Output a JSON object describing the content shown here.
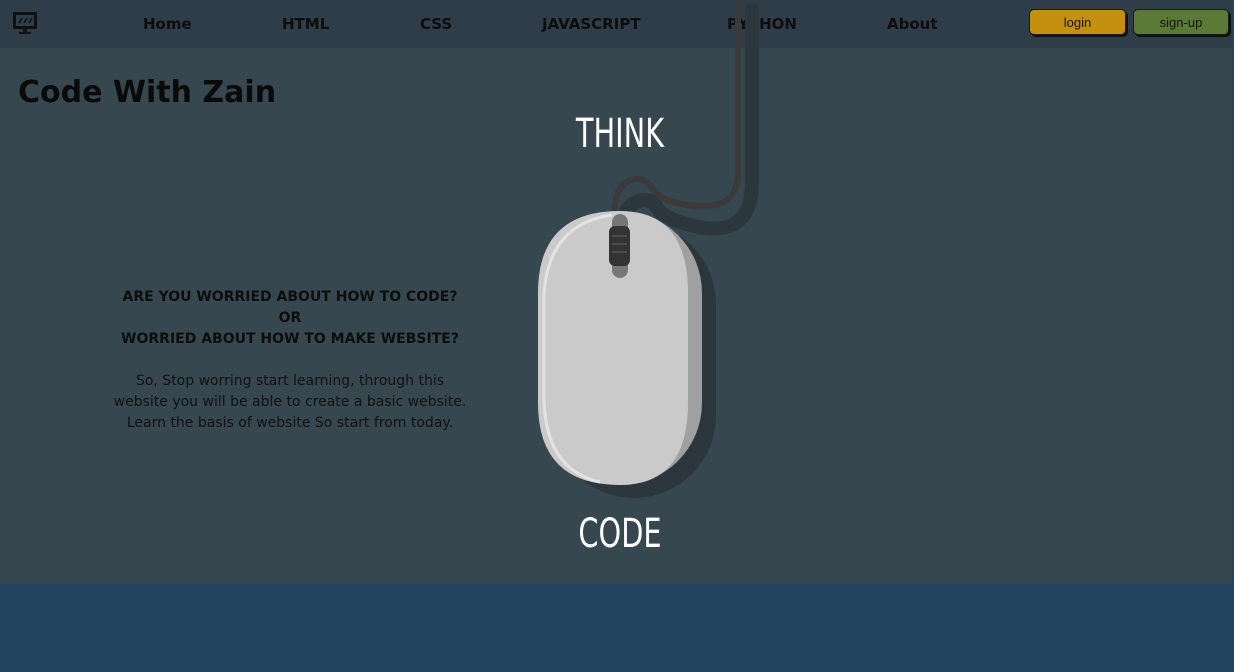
{
  "nav": {
    "logo_icon": "monitor-icon",
    "links": [
      {
        "label": "Home"
      },
      {
        "label": "HTML"
      },
      {
        "label": "CSS"
      },
      {
        "label": "JAVASCRIPT"
      },
      {
        "label": "PYTHON"
      },
      {
        "label": "About"
      }
    ],
    "login_label": "login",
    "signup_label": "sign-up"
  },
  "hero": {
    "title": "Code With Zain",
    "tagline": [
      "ARE YOU WORRIED ABOUT HOW TO CODE?",
      "OR",
      "WORRIED ABOUT HOW TO MAKE WEBSITE?"
    ],
    "description": [
      "So, Stop worring start learning, through this",
      "website you will be able to create a basic website.",
      "Learn the basis of website So start from today."
    ],
    "art": {
      "top_word": "THINK",
      "bottom_word": "CODE",
      "icon": "computer-mouse-icon"
    }
  },
  "colors": {
    "navbar": "#2f3d48",
    "hero": "#37474f",
    "footer": "#234560",
    "login": "#c4900e",
    "signup": "#5b7a35"
  }
}
